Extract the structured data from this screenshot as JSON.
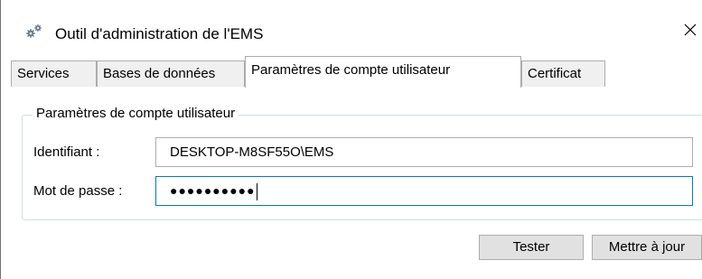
{
  "window": {
    "title": "Outil d'administration de l'EMS",
    "app_icon": "gears-icon",
    "close_glyph": "✕"
  },
  "tabs": [
    {
      "label": "Services",
      "active": false
    },
    {
      "label": "Bases de données",
      "active": false
    },
    {
      "label": "Paramètres de compte utilisateur",
      "active": true
    },
    {
      "label": "Certificat",
      "active": false
    }
  ],
  "account_group": {
    "legend": "Paramètres de compte utilisateur",
    "login_label": "Identifiant :",
    "login_value": "DESKTOP-M8SF55O\\EMS",
    "password_label": "Mot de passe :",
    "password_value": "●●●●●●●●●●"
  },
  "buttons": {
    "test_label": "Tester",
    "update_label": "Mettre à jour"
  },
  "colors": {
    "focus_border": "#0078d7",
    "button_bg": "#e1e1e1",
    "tab_bg": "#f0f0f0"
  }
}
